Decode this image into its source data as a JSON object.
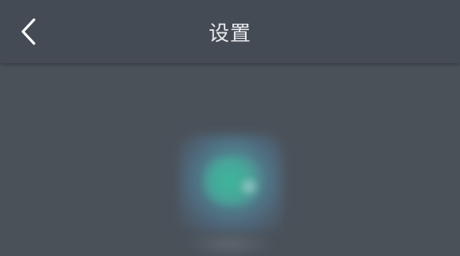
{
  "header": {
    "title": "设置"
  },
  "icons": {
    "back": "chevron-left-icon",
    "app_logo": "app-logo-icon"
  },
  "colors": {
    "header_bg": "#454b54",
    "page_bg": "#4a5159",
    "title_text": "#e8eaec",
    "logo_accent": "#3fb59a"
  }
}
